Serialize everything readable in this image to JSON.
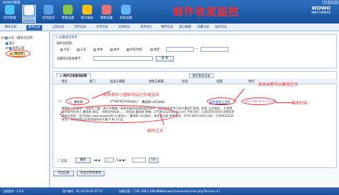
{
  "app": {
    "title": "WOWO管理",
    "banner_title": "邮件收发监控",
    "logo_big": "WOWO",
    "logo_small": "网络行为管理系统"
  },
  "toolbar": [
    {
      "label": "实时管理",
      "icon": "monitor-icon"
    },
    {
      "label": "监控记录",
      "icon": "record-icon"
    },
    {
      "label": "实时监控",
      "icon": "realtime-icon"
    },
    {
      "label": "管理设置",
      "icon": "settings-icon"
    },
    {
      "label": "统计报表",
      "icon": "report-icon"
    },
    {
      "label": "策略设置",
      "icon": "policy-icon"
    },
    {
      "label": "系统设置",
      "icon": "system-icon"
    }
  ],
  "nav_tabs": [
    "聊天记录",
    "邮件记录",
    "上网记录",
    "打印记录",
    "文件外发",
    "文件标记",
    "软件运行",
    "硬件信息",
    "窗口截图",
    "流量记录",
    "操作日志"
  ],
  "tree": {
    "root": "公司（通讯员正常）",
    "node1": "张三",
    "node2": "商务三部",
    "node3": "曹丽章"
  },
  "search": {
    "section_title": "设置查询条件",
    "time_range_label": "按时间范围：",
    "options": [
      "今天",
      "三天",
      "本周",
      "本月",
      "所有时间",
      "指定："
    ],
    "date_from": "",
    "date_to": "",
    "keyword_label": "主题及内容关键字：",
    "keyword_value": "",
    "search_button": "查 询"
  },
  "tabs": {
    "tab1": "邮件记录查询结果",
    "tab2": "清空查询记录"
  },
  "grid": {
    "headers": [
      "姓名",
      "部门",
      "发送方邮箱",
      "接收方邮箱",
      "抄送",
      "标题",
      "时间"
    ],
    "row": {
      "name": "曹丽章",
      "dept": "曹丽章",
      "sender": "2756632234@qq.c",
      "receiver": "曹丽章<652890",
      "cc": "",
      "subject": "软件商务三部来",
      "time": "2011-08-26 11:12:06"
    },
    "body": "尊敬的公司领导：   经初步了解，贵公司需要一套高性能的局域网监控软件，我司相关软件已有大量用户案例。联系 工作指标：    负责数据与软件负责人 曹丽章   电话：    网易发布版本…… 商务部 曹丽章 邮箱：2756632234@qq.com 手机号码：13816563000 详细信息请参见附件。官方网站 www.wowosoft.cn 联系人：曹丽章 公司地址：商务部三部 联系电话：0755-86511053  QQ：2756632234  地址：深圳市南山区科技园科技大厦 A 栋 13 层"
  },
  "annotations": {
    "attach_tip": "点击附件小图标可以打开或另存",
    "subject_tip": "双击标题可以看到正文",
    "body_tip": "邮件正文",
    "time_tip": "具体时间"
  },
  "footer": {
    "select_all": "全选",
    "delete_btn": "删除",
    "export_btn": "导出记录",
    "export_file_btn": "导出文件到本地",
    "page_current": "1",
    "page_total": "1",
    "go_btn": "GO"
  },
  "status": {
    "version": "当前版本：2.0.0",
    "user": "用户编号：9C-26-5A-4F-07-10",
    "mac": "加载页面：[ 192.168.1.188:8888/wowo/screenview/index.php?Record=4 ]"
  },
  "colors": {
    "accent": "#2c66b3",
    "annotation": "#ff2222",
    "banner_title": "#ff2b2b"
  }
}
